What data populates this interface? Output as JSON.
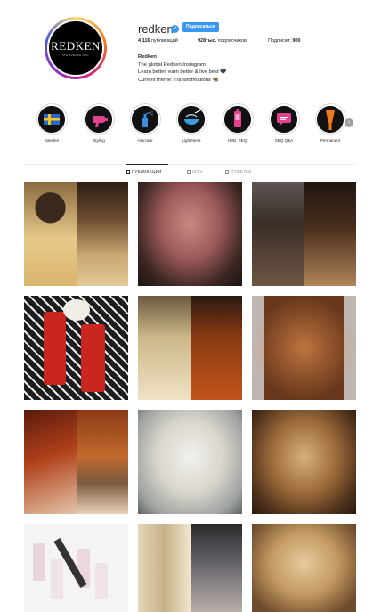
{
  "profile": {
    "username": "redken",
    "verified_mark": "✓",
    "follow_label": "Подписаться",
    "avatar_logo": "REDKEN",
    "avatar_sub": "5TH AVENUE NYC",
    "stats": {
      "posts_count": "4 116",
      "posts_label": " публикаций",
      "followers_count": "928тыс.",
      "followers_label": " подписчиков",
      "following_label": "Подписки: ",
      "following_count": "900"
    },
    "bio": {
      "name": "Redken",
      "line1": "The global Redken Instagram",
      "line2": "Learn better, earn better & live best 🖤",
      "line3": "Current theme: Transformations 🦋"
    }
  },
  "highlights": [
    {
      "label": "Sweden",
      "icon": "sweden-flag-icon"
    },
    {
      "label": "Styling",
      "icon": "hairdryer-icon"
    },
    {
      "label": "Haircare",
      "icon": "spray-bottle-icon"
    },
    {
      "label": "Lighteners",
      "icon": "powder-bowl-icon"
    },
    {
      "label": "HBD, SEQ!",
      "icon": "brush-icon"
    },
    {
      "label": "SEQ Q&A",
      "icon": "chat-bubble-icon"
    },
    {
      "label": "Permanent",
      "icon": "color-brush-icon"
    }
  ],
  "tabs": {
    "posts": "ПУБЛИКАЦИИ",
    "igtv": "IGTV",
    "tagged": "ОТМЕТКИ"
  },
  "colors": {
    "accent": "#3897f0",
    "text": "#262626",
    "muted": "#8e8e8e",
    "divider": "#dbdbdb"
  }
}
